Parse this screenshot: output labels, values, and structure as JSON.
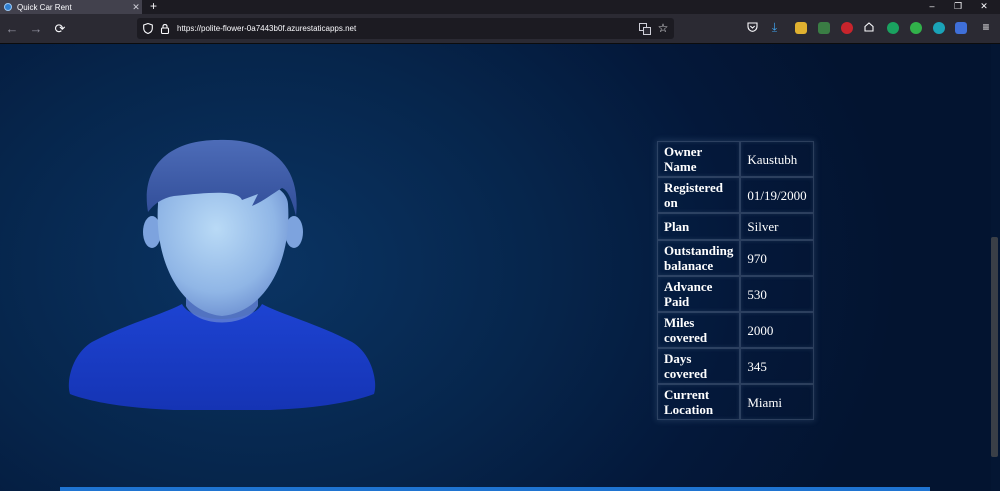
{
  "browser": {
    "tab_title": "Quick Car Rent",
    "url": "https://polite-flower-0a7443b0f.azurestaticapps.net",
    "accent": "#2f7fd0"
  },
  "owner_details": {
    "rows": [
      {
        "key": "Owner Name",
        "value": "Kaustubh"
      },
      {
        "key": "Registered on",
        "value": "01/19/2000"
      },
      {
        "key": "Plan",
        "value": "Silver"
      },
      {
        "key": "Outstanding balanace",
        "value": "970"
      },
      {
        "key": "Advance Paid",
        "value": "530"
      },
      {
        "key": "Miles covered",
        "value": "2000"
      },
      {
        "key": "Days covered",
        "value": "345"
      },
      {
        "key": "Current Location",
        "value": "Miami"
      }
    ]
  },
  "icons": {
    "avatar": "user-avatar-icon",
    "back": "back-arrow-icon",
    "forward": "forward-arrow-icon",
    "reload": "reload-icon",
    "shield": "shield-icon",
    "lock": "lock-icon",
    "translate": "translate-icon",
    "bookmark": "star-icon",
    "menu": "hamburger-menu-icon"
  },
  "colors": {
    "page_background": "#052249",
    "avatar_shirt": "#1a3bc4",
    "avatar_face": "#9cc3ea",
    "avatar_hair": "#3b5ca8"
  }
}
